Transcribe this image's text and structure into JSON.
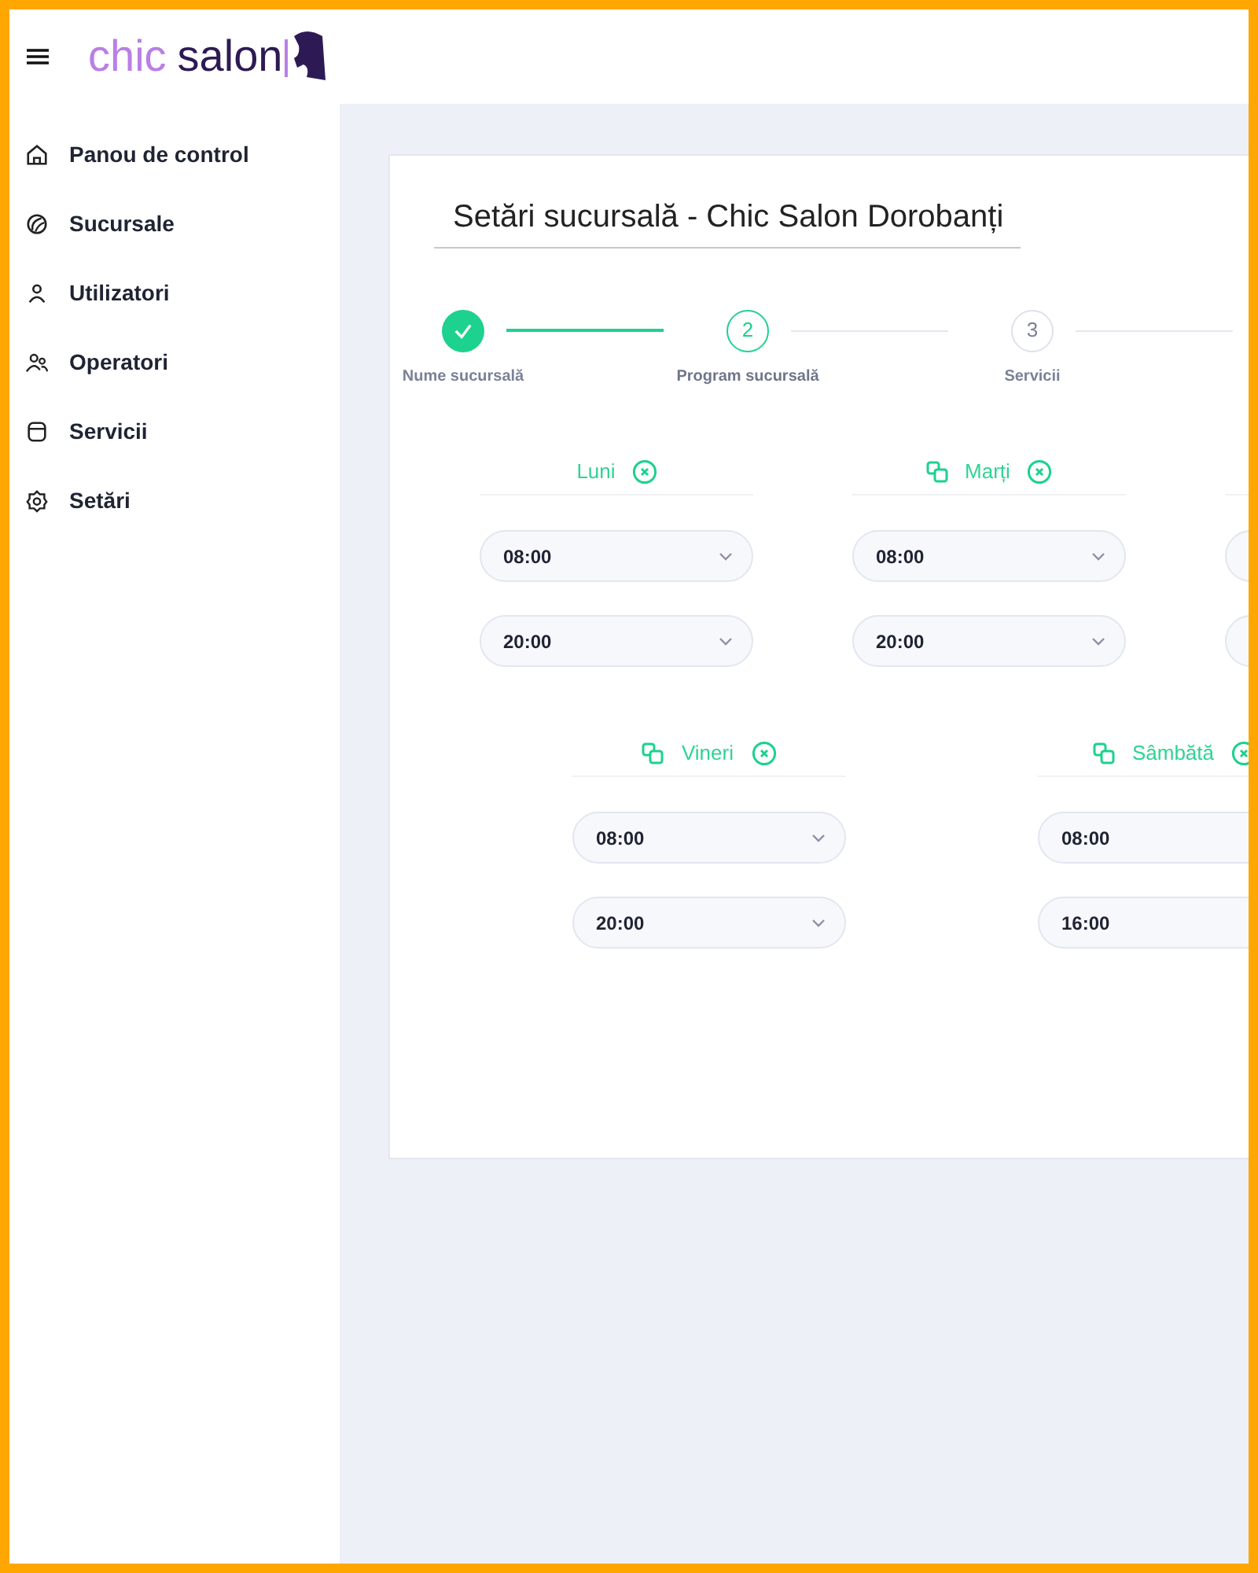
{
  "logo": {
    "word_1": "chic",
    "word_2": "salon"
  },
  "sidebar": {
    "items": [
      {
        "label": "Panou de control"
      },
      {
        "label": "Sucursale"
      },
      {
        "label": "Utilizatori"
      },
      {
        "label": "Operatori"
      },
      {
        "label": "Servicii"
      },
      {
        "label": "Setări"
      }
    ]
  },
  "page": {
    "title": "Setări sucursală - Chic Salon Dorobanți"
  },
  "stepper": [
    {
      "label": "Nume sucursală",
      "completed": true,
      "selected": false
    },
    {
      "number": "2",
      "label": "Program sucursală",
      "completed": false,
      "selected": true
    },
    {
      "number": "3",
      "label": "Servicii",
      "completed": false,
      "selected": false
    }
  ],
  "day_rows": [
    [
      {
        "kind": "day",
        "name": "Luni",
        "copy": false,
        "open": "08:00",
        "close": "20:00"
      },
      {
        "kind": "day",
        "name": "Marți",
        "copy": true,
        "open": "08:00",
        "close": "20:00"
      },
      {
        "kind": "cut-off"
      }
    ],
    [
      {
        "kind": "day",
        "name": "Vineri",
        "copy": true,
        "open": "08:00",
        "close": "20:00"
      },
      {
        "kind": "day",
        "name": "Sâmbătă",
        "copy": true,
        "open": "08:00",
        "close": "16:00"
      }
    ]
  ]
}
